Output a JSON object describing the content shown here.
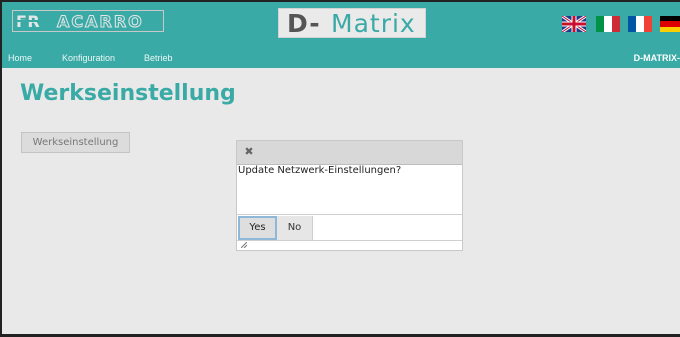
{
  "header": {
    "brand": {
      "prefix": "FR",
      "rest": "ACARRO"
    },
    "product": {
      "prefix": "D-",
      "rest": "Matrix"
    },
    "flags": [
      {
        "icon": "uk-flag-icon"
      },
      {
        "icon": "italy-flag-icon"
      },
      {
        "icon": "france-flag-icon"
      },
      {
        "icon": "germany-flag-icon"
      }
    ],
    "colors": {
      "accent": "#3aaaa6"
    }
  },
  "nav": {
    "items": [
      "Home",
      "Konfiguration",
      "Betrieb"
    ],
    "device_label": "D-MATRIX-"
  },
  "page": {
    "title": "Werkseinstellung",
    "side_button": "Werkseinstellung"
  },
  "dialog": {
    "close_symbol": "✖",
    "message": "Update Netzwerk-Einstellungen?",
    "yes_label": "Yes",
    "no_label": "No"
  }
}
